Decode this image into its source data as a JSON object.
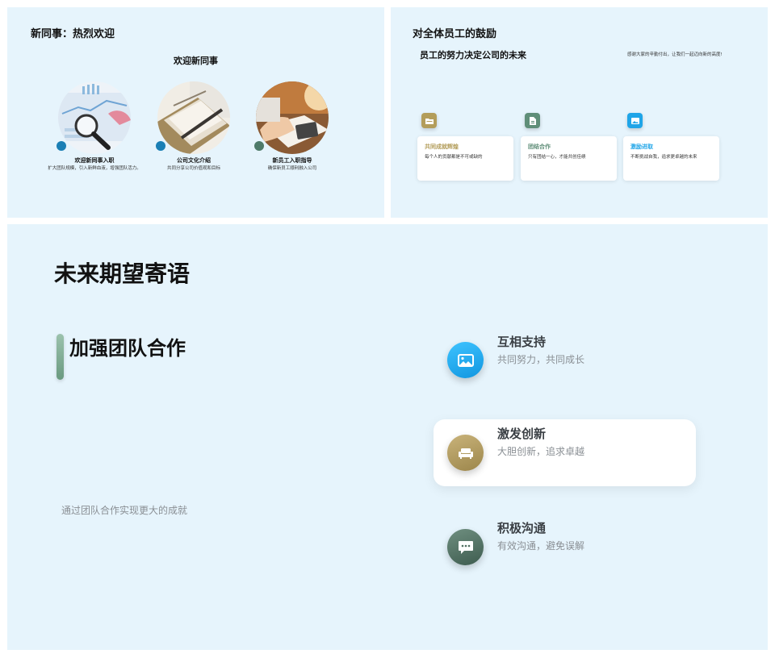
{
  "slide1": {
    "title": "新同事：热烈欢迎",
    "subtitle": "欢迎新同事",
    "cards": [
      {
        "title": "欢迎新同事入职",
        "desc": "扩大团队规模，引入新鲜血液，增强团队活力。",
        "dot_color": "#1a7fb5"
      },
      {
        "title": "公司文化介绍",
        "desc": "共同分享公司价值观和目标",
        "dot_color": "#1a7fb5"
      },
      {
        "title": "新员工入职指导",
        "desc": "确保新员工顺利融入公司",
        "dot_color": "#4e7a69"
      }
    ]
  },
  "slide2": {
    "title": "对全体员工的鼓励",
    "subtitle": "员工的努力决定公司的未来",
    "note": "感谢大家的辛勤付出，让我们一起迈向新的高度!",
    "cards": [
      {
        "icon": "folder-icon",
        "title": "共同成就辉煌",
        "desc": "每个人的贡献都是不可或缺的",
        "color": "#b39d5a"
      },
      {
        "icon": "document-icon",
        "title": "团结合作",
        "desc": "只有团结一心，才能共创佳绩",
        "color": "#5f8e78"
      },
      {
        "icon": "image-icon",
        "title": "激励进取",
        "desc": "不断挑战自我，追求更卓越的未来",
        "color": "#1fa5e8"
      }
    ]
  },
  "slide3": {
    "title": "未来期望寄语",
    "heading": "加强团队合作",
    "slogan": "通过团队合作实现更大的成就",
    "items": [
      {
        "icon": "image-icon",
        "title": "互相支持",
        "desc": "共同努力，共同成长",
        "color": "#1da8ee"
      },
      {
        "icon": "sofa-icon",
        "title": "激发创新",
        "desc": "大胆创新，追求卓越",
        "color": "#b09a5e"
      },
      {
        "icon": "chat-icon",
        "title": "积极沟通",
        "desc": "有效沟通，避免误解",
        "color": "#4f6f61"
      }
    ]
  }
}
